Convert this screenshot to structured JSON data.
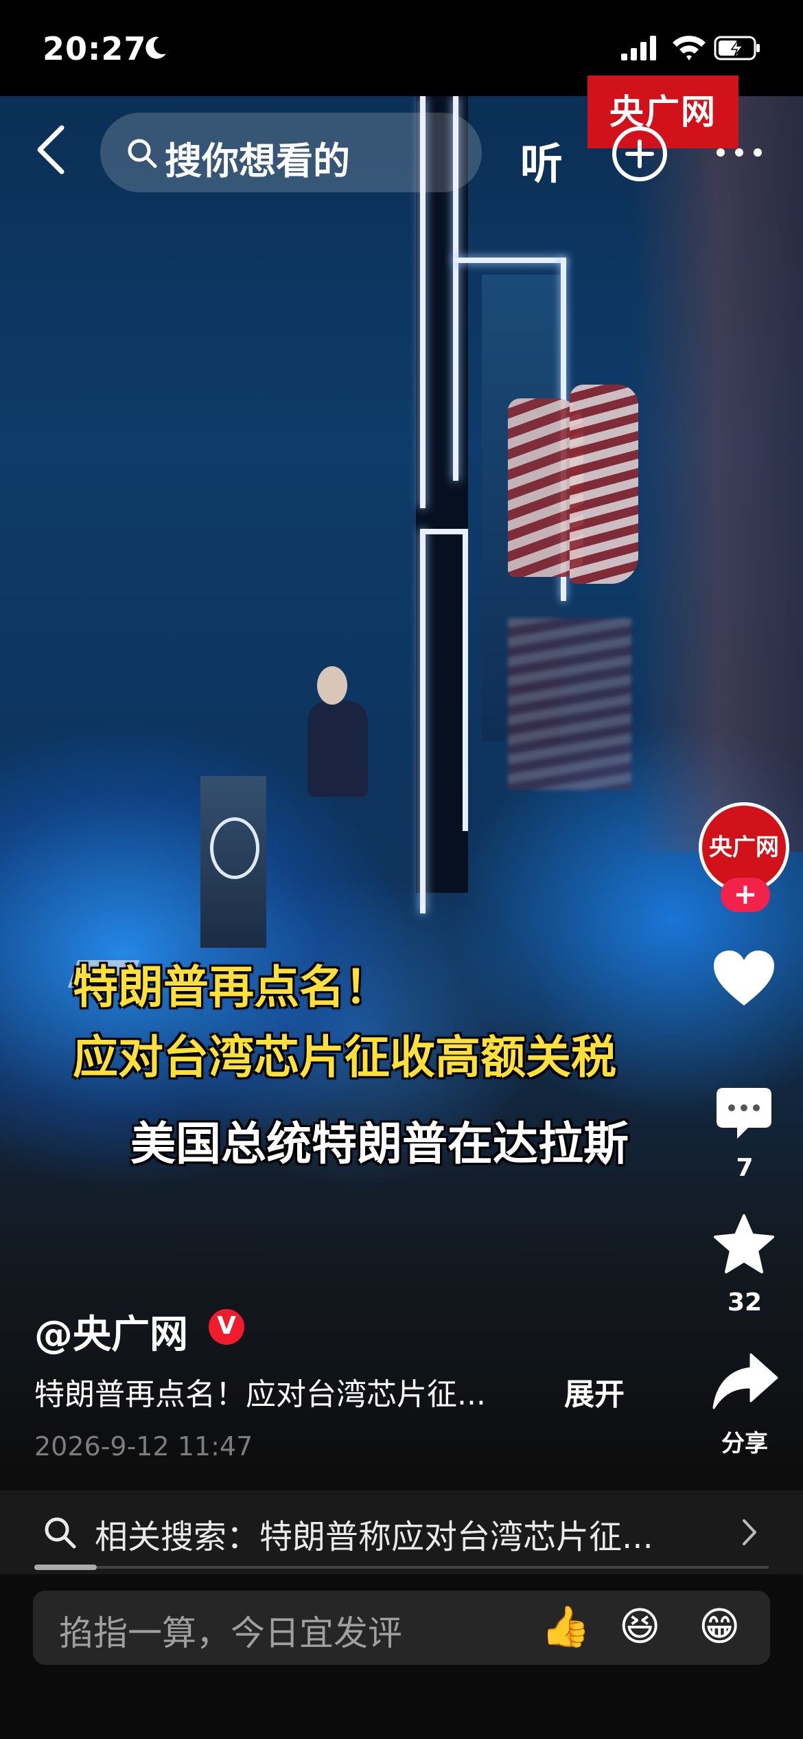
{
  "status_bar": {
    "time": "20:27",
    "icons": [
      "moon-icon",
      "signal-icon",
      "wifi-icon",
      "battery-charging-icon"
    ]
  },
  "top_nav": {
    "search_placeholder": "搜你想看的",
    "listen_label": "听",
    "icons": [
      "back-icon",
      "search-icon",
      "plus-circle-icon",
      "more-icon"
    ]
  },
  "video": {
    "watermark": "央广网",
    "captions": [
      "特朗普再点名！",
      "应对台湾芯片征收高额关税",
      "美国总统特朗普在达拉斯"
    ]
  },
  "right_rail": {
    "avatar_text": "央广网",
    "follow_label": "+",
    "comment_count": "7",
    "favorite_count": "32",
    "share_label": "分享",
    "colors": {
      "accent": "#f2224a",
      "brand": "#d1121b"
    }
  },
  "post": {
    "author": "@央广网",
    "verified_mark": "V",
    "description": "特朗普再点名！应对台湾芯片征...",
    "expand_label": "展开",
    "time": "2026-9-12 11:47"
  },
  "related_search": {
    "text": "相关搜索：特朗普称应对台湾芯片征..."
  },
  "playback": {
    "progress_fraction": 0.085
  },
  "comment_bar": {
    "placeholder": "掐指一算，今日宜发评",
    "emojis": [
      "👍",
      "😆",
      "😁"
    ]
  }
}
